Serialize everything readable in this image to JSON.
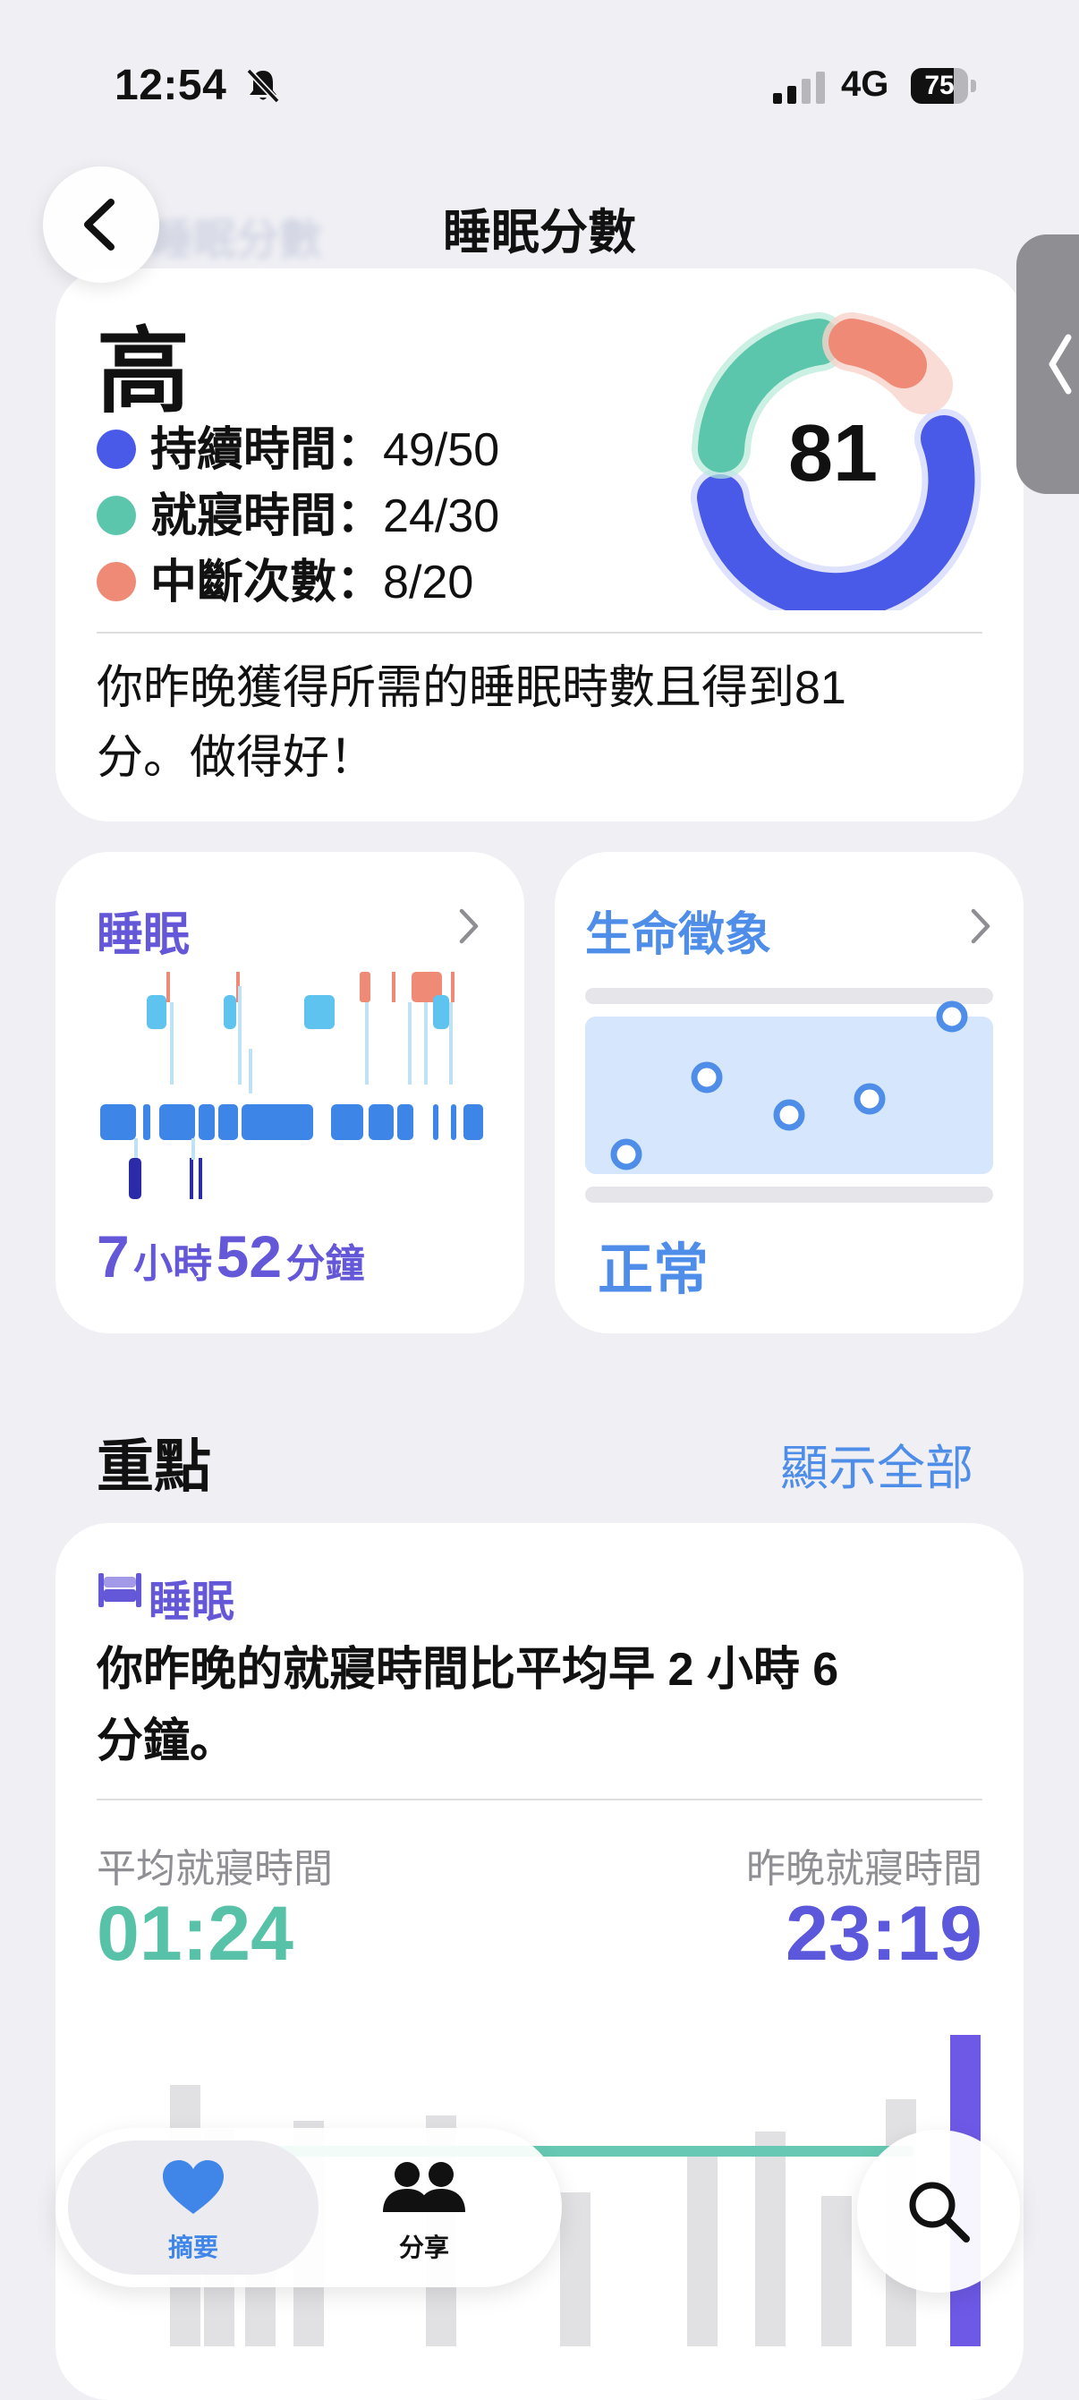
{
  "status_bar": {
    "time": "12:54",
    "network": "4G",
    "battery_level": "75"
  },
  "header": {
    "title": "睡眠分數",
    "ghost_title": "睡眠分數"
  },
  "score": {
    "level": "高",
    "value": "81",
    "metrics": [
      {
        "label": "持續時間",
        "value": "49/50",
        "color": "#4a5ae8"
      },
      {
        "label": "就寢時間",
        "value": "24/30",
        "color": "#5cc6ac"
      },
      {
        "label": "中斷次數",
        "value": "8/20",
        "color": "#ee8a76"
      }
    ],
    "summary": "你昨晚獲得所需的睡眠時數且得到81分。做得好！"
  },
  "sleep_card": {
    "title": "睡眠",
    "hours": "7",
    "hours_unit": "小時",
    "minutes": "52",
    "minutes_unit": "分鐘"
  },
  "vitals_card": {
    "title": "生命徵象",
    "status": "正常"
  },
  "highlights": {
    "heading": "重點",
    "show_all": "顯示全部",
    "tag": "睡眠",
    "body": "你昨晚的就寢時間比平均早 2 小時 6 分鐘。",
    "avg_label": "平均就寢時間",
    "avg_value": "01:24",
    "last_label": "昨晚就寢時間",
    "last_value": "23:19"
  },
  "tabs": [
    {
      "label": "摘要",
      "active": true
    },
    {
      "label": "分享",
      "active": false
    }
  ],
  "colors": {
    "duration": "#4a5ae8",
    "bedtime": "#5cc6ac",
    "interruptions": "#ee8a76",
    "accent_purple": "#6457d8",
    "accent_blue": "#4f8ee8"
  }
}
